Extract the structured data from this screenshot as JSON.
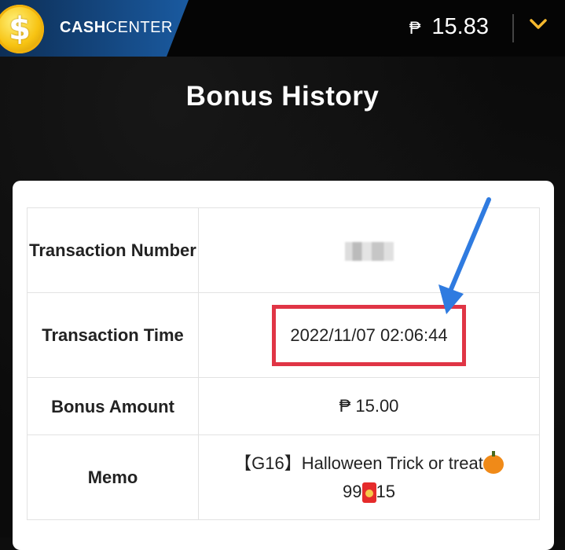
{
  "header": {
    "brand_bold": "CASH",
    "brand_rest": "CENTER",
    "coin_symbol": "$",
    "currency_symbol": "₱",
    "balance": "15.83",
    "colors": {
      "brand_blue": "#1a5aa0",
      "coin_gold": "#f7c312",
      "chevron": "#f5b82e"
    }
  },
  "page": {
    "title": "Bonus History"
  },
  "details": {
    "rows": [
      {
        "label": "Transaction Number",
        "value": ""
      },
      {
        "label": "Transaction Time",
        "value": "2022/11/07 02:06:44"
      },
      {
        "label": "Bonus Amount",
        "value": "₱ 15.00"
      },
      {
        "label": "Memo",
        "value_line1": "【G16】Halloween Trick or treat",
        "value_line2_prefix": "99",
        "value_line2_suffix": "15"
      }
    ],
    "highlight_color": "#e03545",
    "arrow_color": "#2f7be0"
  }
}
